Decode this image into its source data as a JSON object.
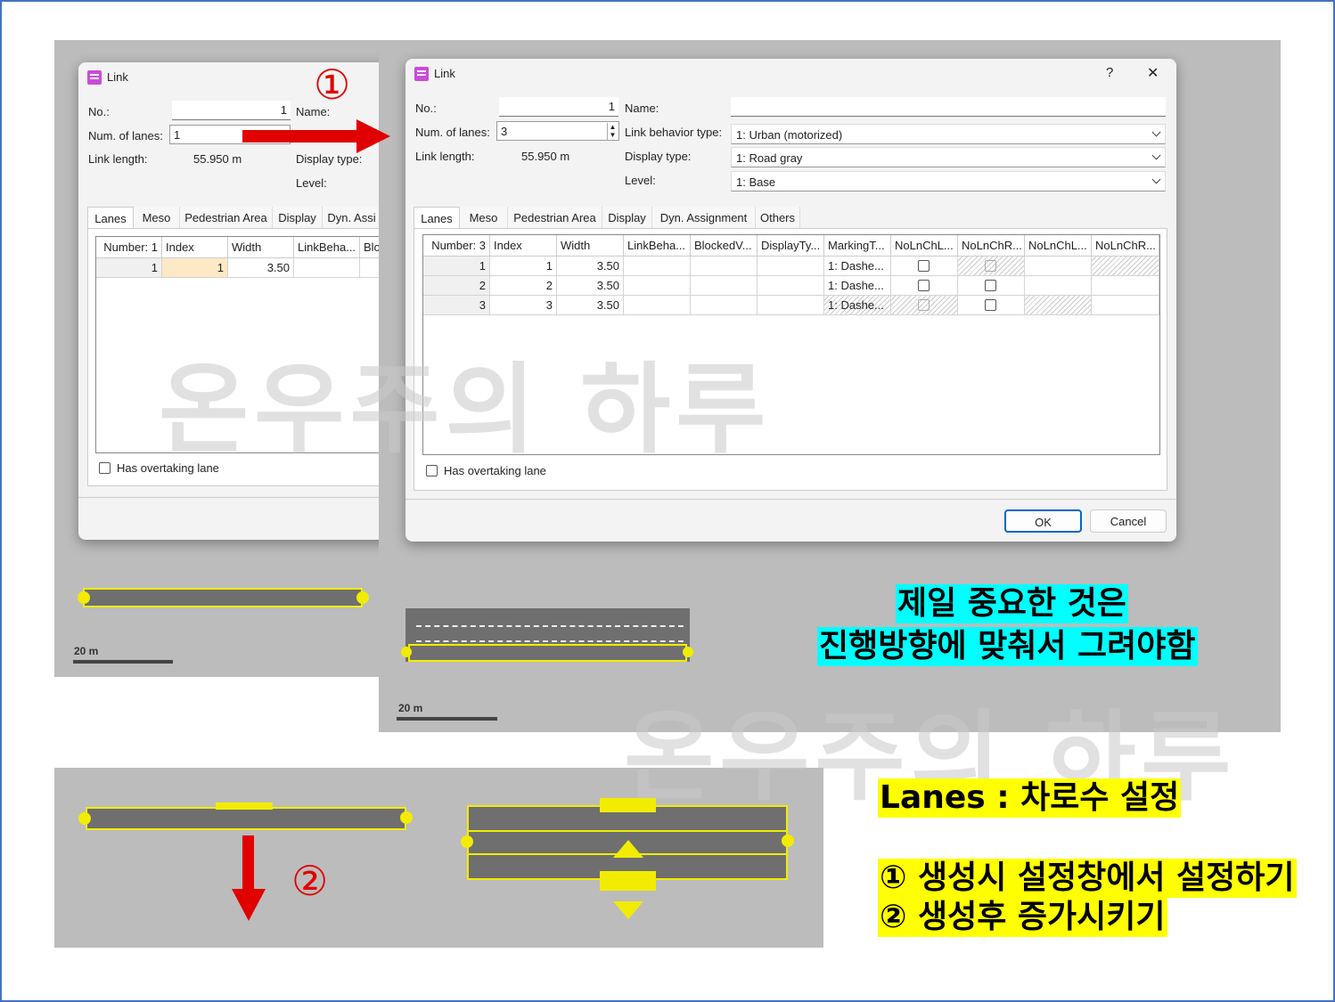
{
  "watermark": "온우주의 하루",
  "step1_marker": "①",
  "step2_marker": "②",
  "scale_label": "20 m",
  "dialog_small": {
    "title": "Link",
    "no_label": "No.:",
    "no_value": "1",
    "name_label": "Name:",
    "lanes_label": "Num. of lanes:",
    "lanes_value": "1",
    "length_label": "Link length:",
    "length_value": "55.950 m",
    "display_label": "Display type:",
    "level_label": "Level:",
    "tabs": [
      "Lanes",
      "Meso",
      "Pedestrian Area",
      "Display",
      "Dyn. Assi"
    ],
    "headers": [
      "Number: 1",
      "Index",
      "Width",
      "LinkBeha...",
      "Blo"
    ],
    "row": [
      "1",
      "1",
      "3.50"
    ],
    "overtaking": "Has overtaking lane"
  },
  "dialog_large": {
    "title": "Link",
    "help": "?",
    "close": "✕",
    "no_label": "No.:",
    "no_value": "1",
    "name_label": "Name:",
    "name_value": "",
    "lanes_label": "Num. of lanes:",
    "lanes_value": "3",
    "behavior_label": "Link behavior type:",
    "behavior_value": "1: Urban (motorized)",
    "length_label": "Link length:",
    "length_value": "55.950 m",
    "display_label": "Display type:",
    "display_value": "1: Road gray",
    "level_label": "Level:",
    "level_value": "1: Base",
    "tabs": [
      "Lanes",
      "Meso",
      "Pedestrian Area",
      "Display",
      "Dyn. Assignment",
      "Others"
    ],
    "headers": [
      "Number: 3",
      "Index",
      "Width",
      "LinkBeha...",
      "BlockedV...",
      "DisplayTy...",
      "MarkingT...",
      "NoLnChL...",
      "NoLnChR...",
      "NoLnChL...",
      "NoLnChR..."
    ],
    "rows": [
      {
        "number": "1",
        "index": "1",
        "width": "3.50",
        "marking": "1: Dashe..."
      },
      {
        "number": "2",
        "index": "2",
        "width": "3.50",
        "marking": "1: Dashe..."
      },
      {
        "number": "3",
        "index": "3",
        "width": "3.50",
        "marking": "1: Dashe..."
      }
    ],
    "overtaking": "Has overtaking lane",
    "ok": "OK",
    "cancel": "Cancel"
  },
  "notes": {
    "important_line1": "제일 중요한 것은",
    "important_line2": "진행방향에 맞춰서 그려야함",
    "lanes_title": "Lanes : 차로수 설정",
    "method1": "① 생성시 설정창에서 설정하기",
    "method2": "② 생성후 증가시키기"
  },
  "colors": {
    "arrow": "#e00000",
    "highlight_yellow": "#ffff00",
    "highlight_cyan": "#00ffff",
    "link_outline": "#f2ec00"
  }
}
